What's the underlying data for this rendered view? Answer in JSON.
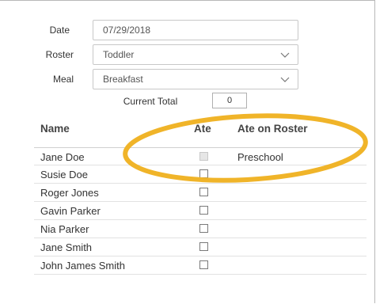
{
  "form": {
    "date_label": "Date",
    "date_value": "07/29/2018",
    "roster_label": "Roster",
    "roster_value": "Toddler",
    "meal_label": "Meal",
    "meal_value": "Breakfast",
    "current_total_label": "Current Total",
    "current_total_value": "0"
  },
  "table": {
    "headers": {
      "name": "Name",
      "ate": "Ate",
      "ate_on_roster": "Ate on Roster"
    },
    "rows": [
      {
        "name": "Jane Doe",
        "ate": false,
        "disabled": true,
        "ate_on_roster": "Preschool"
      },
      {
        "name": "Susie Doe",
        "ate": false,
        "disabled": false,
        "ate_on_roster": ""
      },
      {
        "name": "Roger Jones",
        "ate": false,
        "disabled": false,
        "ate_on_roster": ""
      },
      {
        "name": "Gavin Parker",
        "ate": false,
        "disabled": false,
        "ate_on_roster": ""
      },
      {
        "name": "Nia Parker",
        "ate": false,
        "disabled": false,
        "ate_on_roster": ""
      },
      {
        "name": "Jane Smith",
        "ate": false,
        "disabled": false,
        "ate_on_roster": ""
      },
      {
        "name": "John James Smith",
        "ate": false,
        "disabled": false,
        "ate_on_roster": ""
      }
    ]
  },
  "annotation": {
    "color": "#f0b429"
  }
}
